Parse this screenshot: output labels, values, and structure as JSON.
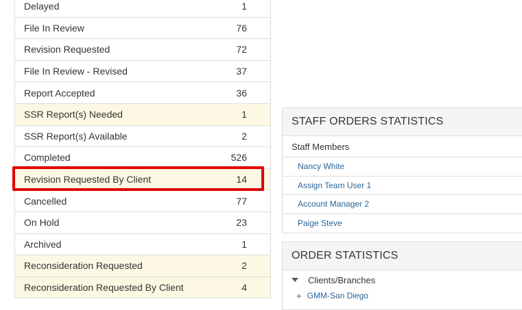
{
  "status_rows": [
    {
      "label": "Delayed",
      "count": "1",
      "highlight": false
    },
    {
      "label": "File In Review",
      "count": "76",
      "highlight": false
    },
    {
      "label": "Revision Requested",
      "count": "72",
      "highlight": false
    },
    {
      "label": "File In Review - Revised",
      "count": "37",
      "highlight": false
    },
    {
      "label": "Report Accepted",
      "count": "36",
      "highlight": false
    },
    {
      "label": "SSR Report(s) Needed",
      "count": "1",
      "highlight": true
    },
    {
      "label": "SSR Report(s) Available",
      "count": "2",
      "highlight": false
    },
    {
      "label": "Completed",
      "count": "526",
      "highlight": false
    },
    {
      "label": "Revision Requested By Client",
      "count": "14",
      "highlight": true
    },
    {
      "label": "Cancelled",
      "count": "77",
      "highlight": false
    },
    {
      "label": "On Hold",
      "count": "23",
      "highlight": false
    },
    {
      "label": "Archived",
      "count": "1",
      "highlight": false
    },
    {
      "label": "Reconsideration Requested",
      "count": "2",
      "highlight": true
    },
    {
      "label": "Reconsideration Requested By Client",
      "count": "4",
      "highlight": true
    }
  ],
  "staff_panel": {
    "title": "STAFF ORDERS STATISTICS",
    "column_header": "Staff Members",
    "members": [
      "Nancy White",
      "Assign Team User 1",
      "Account Manager 2",
      "Paige Steve"
    ]
  },
  "order_panel": {
    "title": "ORDER STATISTICS",
    "tree_header": "Clients/Branches",
    "branches": [
      "GMM-San Diego"
    ]
  },
  "colors": {
    "highlight_row": "#fcf8e3",
    "annotation_box": "#e30000",
    "link": "#2a6496"
  }
}
